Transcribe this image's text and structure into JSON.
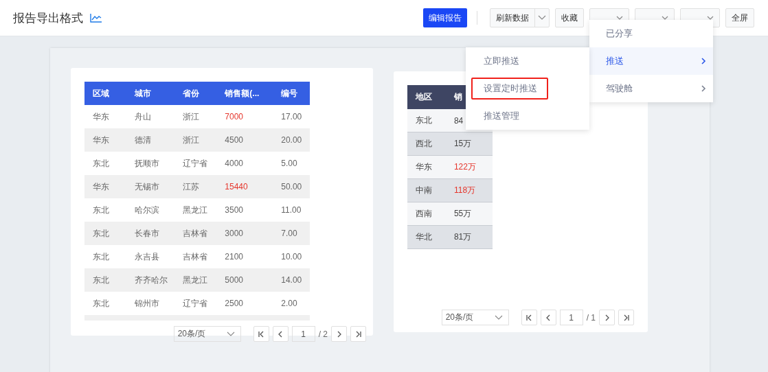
{
  "header": {
    "title": "报告导出格式",
    "primary_button": "编辑报告",
    "split_button": "刷新数据",
    "buttons": [
      {
        "label": "收藏",
        "kind": "plain"
      },
      {
        "kind": "dropdown"
      },
      {
        "kind": "dropdown"
      },
      {
        "kind": "dropdown"
      },
      {
        "label": "全屏",
        "kind": "plain"
      }
    ]
  },
  "bookmark_menu": {
    "items": [
      {
        "label": "已分享",
        "selected": false,
        "has_submenu": false
      },
      {
        "label": "推送",
        "selected": true,
        "has_submenu": true
      },
      {
        "label": "驾驶舱",
        "selected": false,
        "has_submenu": true
      }
    ]
  },
  "push_menu": {
    "items": [
      {
        "label": "立即推送",
        "highlighted": false
      },
      {
        "label": "设置定时推送",
        "highlighted": true
      },
      {
        "label": "推送管理",
        "highlighted": false
      }
    ]
  },
  "left_table": {
    "columns": [
      "区域",
      "城市",
      "省份",
      "销售额(...",
      "编号"
    ],
    "rows": [
      {
        "cells": [
          "华东",
          "舟山",
          "浙江",
          "7000",
          "17.00"
        ],
        "warning": true
      },
      {
        "cells": [
          "华东",
          "德清",
          "浙江",
          "4500",
          "20.00"
        ],
        "warning": false
      },
      {
        "cells": [
          "东北",
          "抚顺市",
          "辽宁省",
          "4000",
          "5.00"
        ],
        "warning": false
      },
      {
        "cells": [
          "华东",
          "无锡市",
          "江苏",
          "15440",
          "50.00"
        ],
        "warning": true
      },
      {
        "cells": [
          "东北",
          "哈尔滨",
          "黑龙江",
          "3500",
          "11.00"
        ],
        "warning": false
      },
      {
        "cells": [
          "东北",
          "长春市",
          "吉林省",
          "3000",
          "7.00"
        ],
        "warning": false
      },
      {
        "cells": [
          "东北",
          "永吉县",
          "吉林省",
          "2100",
          "10.00"
        ],
        "warning": false
      },
      {
        "cells": [
          "东北",
          "齐齐哈尔",
          "黑龙江",
          "5000",
          "14.00"
        ],
        "warning": false
      },
      {
        "cells": [
          "东北",
          "锦州市",
          "辽宁省",
          "2500",
          "2.00"
        ],
        "warning": false
      }
    ],
    "pagination": {
      "page_size": "20条/页",
      "page": "1",
      "total": "/ 2"
    }
  },
  "right_table": {
    "columns": [
      "地区",
      "销"
    ],
    "rows": [
      {
        "cells": [
          "东北",
          "84"
        ],
        "warning": false
      },
      {
        "cells": [
          "西北",
          "15万"
        ],
        "warning": false
      },
      {
        "cells": [
          "华东",
          "122万"
        ],
        "warning": true
      },
      {
        "cells": [
          "中南",
          "118万"
        ],
        "warning": true
      },
      {
        "cells": [
          "西南",
          "55万"
        ],
        "warning": false
      },
      {
        "cells": [
          "华北",
          "81万"
        ],
        "warning": false
      }
    ],
    "pagination": {
      "page_size": "20条/页",
      "page": "1",
      "total": "/ 1"
    }
  }
}
